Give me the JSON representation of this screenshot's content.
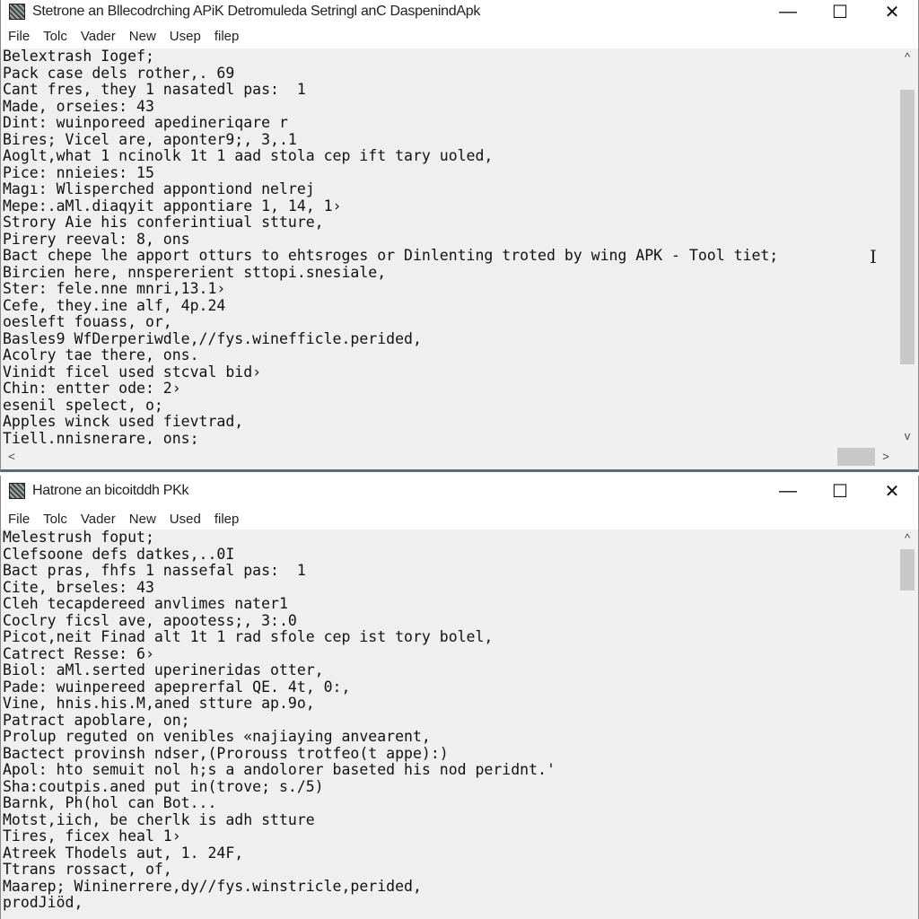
{
  "window1": {
    "title": "Stetrone an Bllecodrching APiK Detromuleda Setringl anC DaspenindApk",
    "menu": [
      "File",
      "Tolc",
      "Vader",
      "New",
      "Usep",
      "filep"
    ],
    "lines": [
      "Belextrash Iogef;",
      "Pack case dels rother,. 69",
      "Cant fres, they 1 nasatedl pas:  1",
      "Made, orseies: 43",
      "Dint: wuinporeed apedineriqare r",
      "Bires; Vicel are, aponter9;, 3,.1",
      "Aoglt,what 1 ncinolk 1t 1 aad stola cep ift tary uoled,",
      "Pice: nnieies: 15",
      "Magı: Wlisperched appontiond nelrej",
      "Mepe:.aMl.diaqyit appontiare 1, 14, 1›",
      "Strory Aie his conferintiual stture,",
      "Pirery reeval: 8, ons",
      "Bact chepe lhe apport otturs to ehtsroges or Dinlenting troted by wing APK - Tool tiet;",
      "Bircien here, nnspererient sttopi.snesiale,",
      "Ster: fele.nne mnri,13.1›",
      "Cefe, they.ine alf, 4p.24",
      "oesleft fouass, or,",
      "Basles9 WfDerperiwdle,//fys.winefficle.perided,",
      "Acolry tae there, ons.",
      "Vinidt ficel used stcval bid›",
      "Chin: entter ode: 2›",
      "esenil spelect, o;",
      "Apples winck used fievtrad,",
      "Tiell.nnisnerare, ons;"
    ]
  },
  "window2": {
    "title": "Hatrone an bicoitddh PKk",
    "menu": [
      "File",
      "Tolc",
      "Vader",
      "New",
      "Used",
      "filep"
    ],
    "lines": [
      "Melestrush foput;",
      "Clefsoone defs datkes,..0I",
      "Bact pras, fhfs 1 nassefal pas:  1",
      "Cite, brseles: 43",
      "Cleh tecapdereed anvlimes nater1",
      "Coclry ficsl ave, apootess;, 3:.0",
      "Picot,neit Finad alt 1t 1 rad sfole cep ist tory bolel,",
      "Catrect Resse: 6›",
      "Biol: aMl.serted uperineridas otter,",
      "Pade: wuinpereed apeprerfal QE. 4t, 0:,",
      "Vine, hnis.his.M,aned stture ap.9o,",
      "Patract apoblare, on;",
      "Prolup reguted on venibles «najiaying anvearent,",
      "Bactect provinsh ndser,(Prorouss trotfeo(t appe):)",
      "Apol: hto semuit nol h;s a andolorer baseted his nod peridnt.'",
      "Sha:coutpis.aned put in(trove; s./5)",
      "Barnk, Ph(hol can Bot...",
      "Motst,iich, be cherlk is adh stture",
      "Tires, ficex heal 1›",
      "Atreek Thodels aut, 1. 24F,",
      "Ttrans rossact, of,",
      "Maarep; Wininerrere,dy//fys.winstricle,perided,",
      "prodJiöd,"
    ]
  },
  "controls": {
    "minimize": "—",
    "maximize": "☐",
    "close": "✕",
    "up": "^",
    "down": "v",
    "left": "<",
    "right": ">"
  },
  "cursor": "I"
}
